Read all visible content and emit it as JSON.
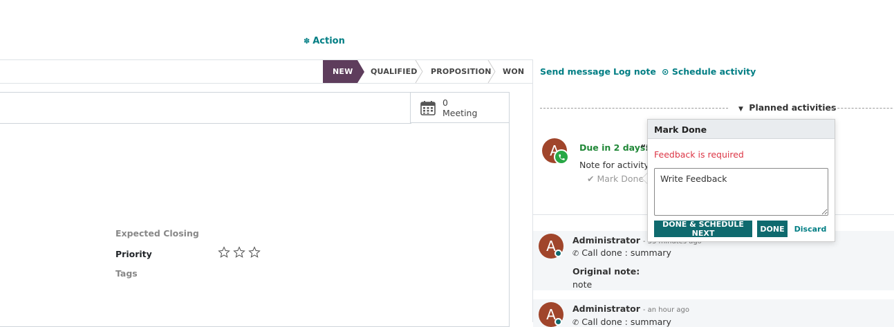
{
  "toolbar": {
    "action_label": "Action"
  },
  "statusbar": {
    "stages": [
      {
        "label": "NEW",
        "active": true
      },
      {
        "label": "QUALIFIED",
        "active": false
      },
      {
        "label": "PROPOSITION",
        "active": false
      },
      {
        "label": "WON",
        "active": false
      }
    ]
  },
  "smart_button": {
    "count": "0",
    "label": "Meeting"
  },
  "form": {
    "expected_closing_label": "Expected Closing",
    "priority_label": "Priority",
    "tags_label": "Tags",
    "priority_stars": 0
  },
  "chatter": {
    "send_message": "Send message",
    "log_note": "Log note",
    "schedule_activity": "Schedule activity",
    "planned_activities": "Planned activities",
    "activity": {
      "avatar_letter": "A",
      "due": "Due in 2 days:",
      "summary": "“D",
      "note": "Note for activity",
      "mark_done": "Mark Done"
    },
    "messages": [
      {
        "avatar_letter": "A",
        "author": "Administrator",
        "time": "- 33 minutes ago",
        "body": "Call done : summary",
        "original_note_label": "Original note:",
        "original_note": "note"
      },
      {
        "avatar_letter": "A",
        "author": "Administrator",
        "time": "- an hour ago",
        "body": "Call done : summary"
      }
    ]
  },
  "popover": {
    "title": "Mark Done",
    "feedback_required": "Feedback is required",
    "feedback_placeholder": "Write Feedback",
    "done_schedule_next": "DONE & SCHEDULE NEXT",
    "done": "DONE",
    "discard": "Discard"
  },
  "colors": {
    "accent": "#017e84",
    "stage_active": "#5e3d5c",
    "primary_button": "#0f6a6e",
    "error": "#dc3545",
    "due": "#218838"
  }
}
